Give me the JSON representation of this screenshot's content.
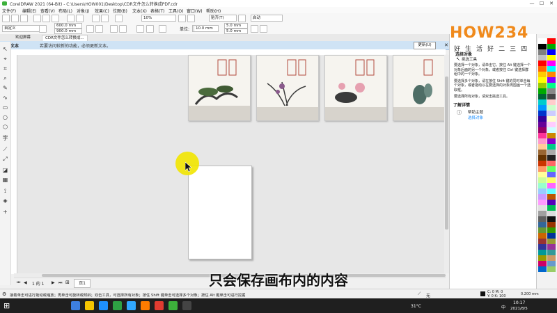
{
  "window": {
    "title": "CorelDRAW 2021 (64-Bit) - C:\\Users\\HOW001\\Desktop\\CDR文件怎么转换成PDF.cdr",
    "min": "—",
    "max": "☐",
    "close": "✕"
  },
  "menu": [
    "文件(F)",
    "编辑(E)",
    "查看(V)",
    "布局(L)",
    "对象(J)",
    "效果(C)",
    "位图(B)",
    "文本(X)",
    "表格(T)",
    "工具(O)",
    "窗口(W)",
    "帮助(H)"
  ],
  "toolbar1": {
    "zoom": "10%",
    "snap": "贴齐(T)",
    "launch": "启动"
  },
  "toolbar2": {
    "preset": "自定义",
    "width": "600.0 mm",
    "height": "900.0 mm",
    "units_label": "单位:",
    "units": "毫米",
    "nudge": "10.0 mm",
    "dup_x": "5.0 mm",
    "dup_y": "5.0 mm"
  },
  "tabs": [
    "欢迎屏幕",
    "CDR文件怎么转换成..."
  ],
  "notice": {
    "title": "更新文本",
    "text": "若要访问较新的功能，必须更新文本。",
    "button": "更新(U)"
  },
  "panel": {
    "logo": "HOW234",
    "subtitle_chars": [
      "好",
      "生",
      "活",
      "好",
      "二",
      "三",
      "四"
    ],
    "heading": "选择对象",
    "tool_name": "挑选工具",
    "bullets": [
      "要选择一个对象，请单击它。按住 Alt 键选择一个对象后面的另一个对象，或者按住 Ctrl 键选择群组中的一个对象。",
      "要选择多个对象，请在按住 Shift 键的同时单击每个对象，或者拖动以在要选择的对象周围画一个选取框。",
      "要选择所有对象，请双击挑选工具。"
    ],
    "more": "了解详情",
    "help_topic": "帮助主题",
    "help_link": "选择对象"
  },
  "status": {
    "hint": "接着单击可进行拖动或缩放；再单击可旋转或倾斜；双击工具，可选择所有对象；按住 Shift 键单击可选择多个对象；按住 Alt 键单击可进行挖掘",
    "page_tab": "页1",
    "page_counter": "1 的 1",
    "fill_label": "无",
    "coords_c": "C: 0 M: 0",
    "coords_y": "Y: 0 K: 100",
    "stroke": "0.200 mm"
  },
  "subtitle": "只会保存画布内的内容",
  "taskbar": {
    "time": "10:17",
    "date": "2021/8/5",
    "weather": "31°C",
    "lang": "中"
  },
  "colors": {
    "accent": "#1e90ff",
    "notice_bg": "#cfe3f5",
    "cursor_highlight": "#f2e600"
  }
}
